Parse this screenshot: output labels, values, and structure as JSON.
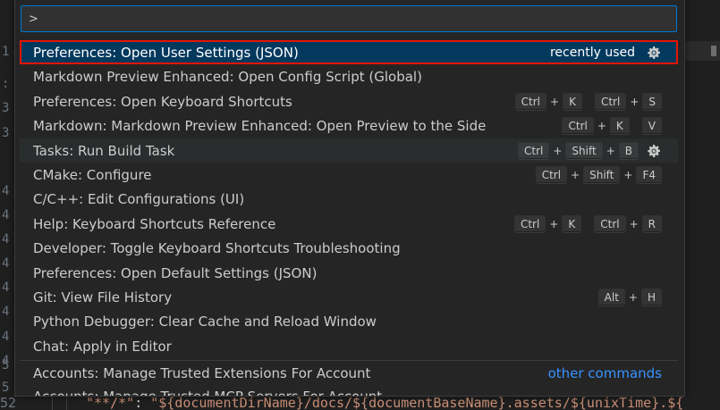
{
  "quick_pick": {
    "input_value": ">",
    "items": [
      {
        "label": "Preferences: Open User Settings (JSON)",
        "description": "recently used",
        "gear": true,
        "selected": true,
        "keybindings": []
      },
      {
        "label": "Markdown Preview Enhanced: Open Config Script (Global)",
        "keybindings": []
      },
      {
        "label": "Preferences: Open Keyboard Shortcuts",
        "keybindings": [
          [
            "Ctrl",
            "K"
          ],
          [
            "Ctrl",
            "S"
          ]
        ]
      },
      {
        "label": "Markdown: Markdown Preview Enhanced: Open Preview to the Side",
        "keybindings": [
          [
            "Ctrl",
            "K"
          ],
          [
            "V"
          ]
        ]
      },
      {
        "label": "Tasks: Run Build Task",
        "gear": true,
        "hover": true,
        "keybindings": [
          [
            "Ctrl",
            "Shift",
            "B"
          ]
        ]
      },
      {
        "label": "CMake: Configure",
        "keybindings": [
          [
            "Ctrl",
            "Shift",
            "F4"
          ]
        ]
      },
      {
        "label": "C/C++: Edit Configurations (UI)",
        "keybindings": []
      },
      {
        "label": "Help: Keyboard Shortcuts Reference",
        "keybindings": [
          [
            "Ctrl",
            "K"
          ],
          [
            "Ctrl",
            "R"
          ]
        ]
      },
      {
        "label": "Developer: Toggle Keyboard Shortcuts Troubleshooting",
        "keybindings": []
      },
      {
        "label": "Preferences: Open Default Settings (JSON)",
        "keybindings": []
      },
      {
        "label": "Git: View File History",
        "keybindings": [
          [
            "Alt",
            "H"
          ]
        ]
      },
      {
        "label": "Python Debugger: Clear Cache and Reload Window",
        "keybindings": []
      },
      {
        "label": "Chat: Apply in Editor",
        "keybindings": []
      }
    ],
    "other_section": {
      "label": "Accounts: Manage Trusted Extensions For Account",
      "link": "other commands"
    },
    "partial_item": "Accounts: Manage Trusted MCP Servers For Account"
  },
  "editor": {
    "gutter_numbers": [
      "1",
      ":",
      "3",
      "3",
      "4",
      "4",
      "4",
      "4",
      "4",
      "4",
      "4",
      "4",
      "5",
      "5"
    ],
    "bottom_line_number": "52",
    "bottom_code_key": "\"**/*\"",
    "bottom_code_punc": ": ",
    "bottom_code_value": "\"${documentDirName}/docs/${documentBaseName}.assets/${unixTime}.${"
  },
  "colors": {
    "selection_bg": "#04395e",
    "focus_border": "#e51400",
    "input_border": "#0078d4",
    "link": "#3794ff"
  },
  "icons": {
    "gear": "gear-icon"
  }
}
